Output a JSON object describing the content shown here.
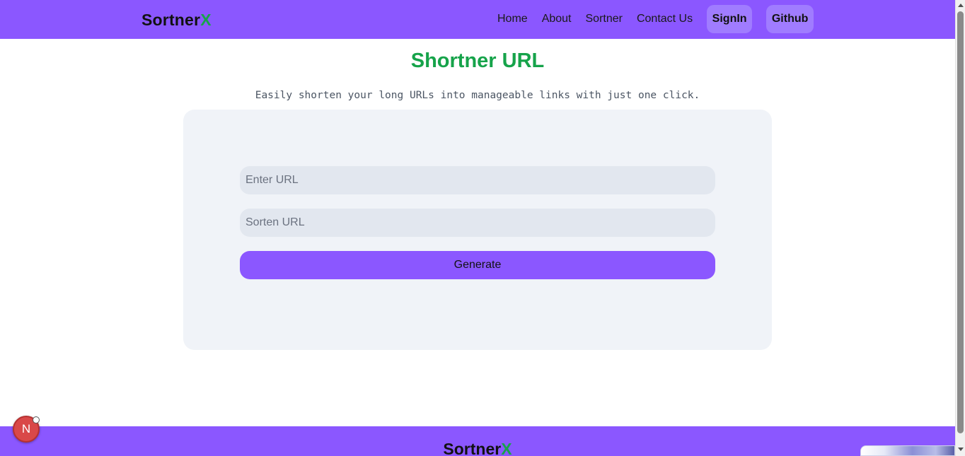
{
  "navbar": {
    "brand_main": "Sortner",
    "brand_accent": "X",
    "links": [
      "Home",
      "About",
      "Sortner",
      "Contact Us"
    ],
    "signin_label": "SignIn",
    "github_label": "Github"
  },
  "hero": {
    "title": "Shortner URL",
    "subtitle": "Easily shorten your long URLs into manageable links with just one click."
  },
  "form": {
    "url_placeholder": "Enter URL",
    "short_placeholder": "Sorten URL",
    "generate_label": "Generate"
  },
  "footer": {
    "brand_main": "Sortner",
    "brand_accent": "X"
  },
  "badge": {
    "letter": "N"
  },
  "colors": {
    "primary": "#8b57ff",
    "accent_green": "#16a34a",
    "card_bg": "#f0f3f8",
    "input_bg": "#e2e7ef",
    "button_light": "#a07cff"
  }
}
